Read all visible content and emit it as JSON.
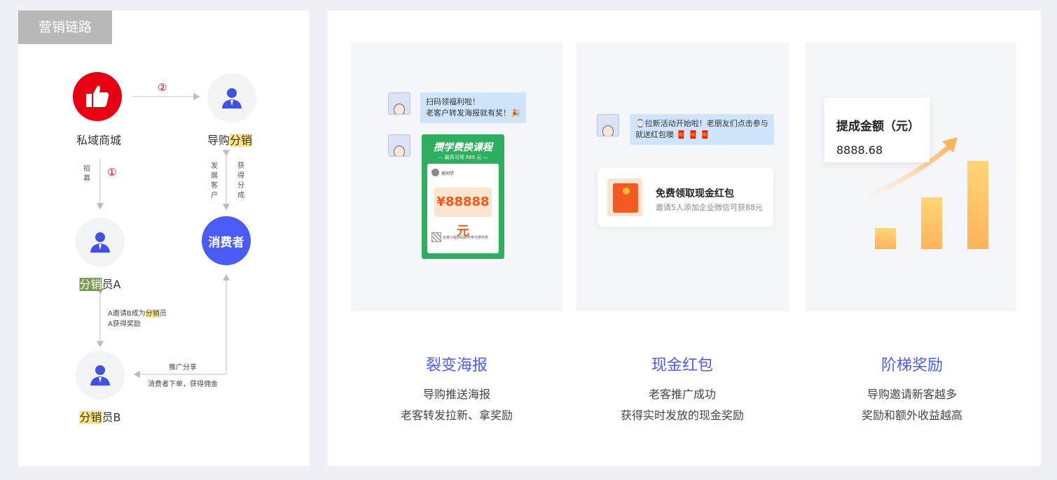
{
  "left": {
    "tag": "营销链路",
    "nodes": {
      "private_mall": "私域商城",
      "guide_prefix": "导购",
      "guide_highlight": "分销",
      "consumer": "消费者",
      "dist_a_highlight": "分销",
      "dist_a_suffix": "员A",
      "dist_b_highlight": "分销",
      "dist_b_suffix": "员B"
    },
    "steps": {
      "one": "①",
      "two": "②"
    },
    "labels": {
      "recruit": "招募",
      "develop_customers": "发展客户",
      "get_commission_share": "获得分成",
      "invite_line1_prefix": "A邀请B成为",
      "invite_line1_highlight": "分销",
      "invite_line1_suffix": "员",
      "invite_line2": "A获得奖励",
      "promote_share": "推广分享",
      "consumer_order": "消费者下单，获得佣金"
    }
  },
  "cards": [
    {
      "title": "裂变海报",
      "desc1": "导购推送海报",
      "desc2": "老客转发拉新、拿奖励",
      "bubble1": "扫码领福利啦！",
      "bubble2": "老客户转发海报就有奖！🎉",
      "poster_title": "攒学费换课程",
      "poster_sub": "— 最高可领 888 元 —",
      "poster_name": "吴同学",
      "poster_amount": "¥88888元",
      "poster_foot": "长按小程序码即可参与攒学费"
    },
    {
      "title": "现金红包",
      "desc1": "老客推广成功",
      "desc2": "获得实时发放的现金奖励",
      "bubble1": "⌚拉新活动开始啦！老朋友们点击参与",
      "bubble2": "就送红包噢 🧧 🧧 🧧",
      "rp_title": "免费领取现金红包",
      "rp_desc": "邀请5人添加企业微信可获88元"
    },
    {
      "title": "阶梯奖励",
      "desc1": "导购邀请新客越多",
      "desc2": "奖励和额外收益越高",
      "amount_label": "提成金额（元）",
      "amount_value": "8888.68"
    }
  ],
  "colors": {
    "accent_blue": "#4a5bf6",
    "brand_red": "#e60012",
    "highlight_yellow": "#fde383"
  }
}
